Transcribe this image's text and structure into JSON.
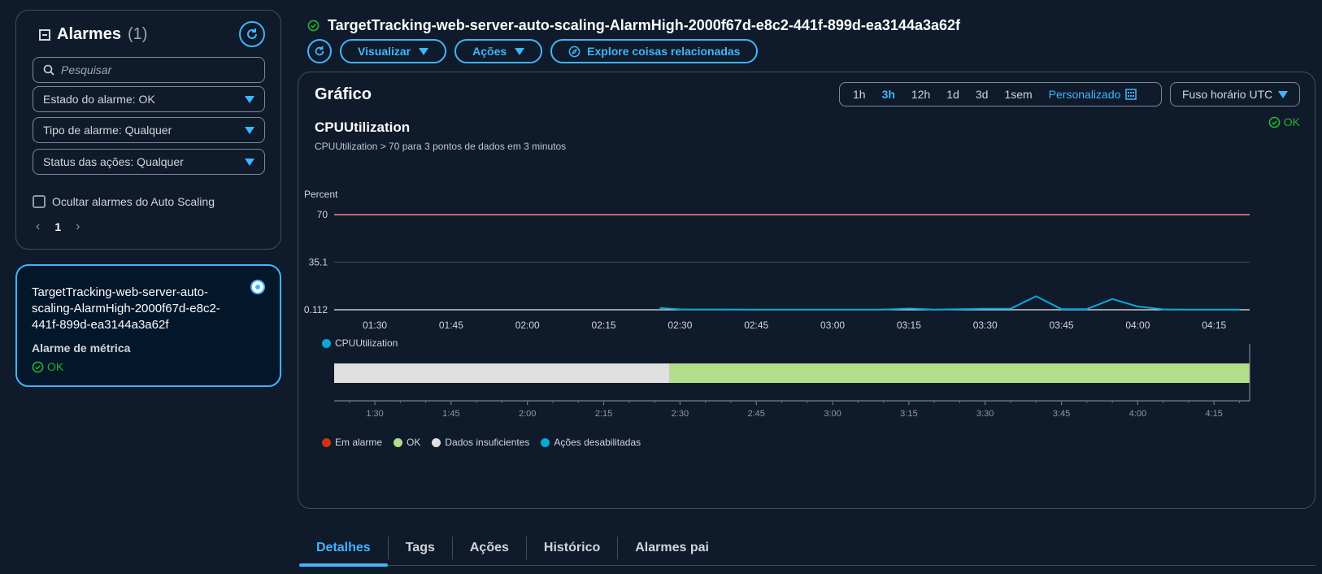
{
  "sidebar": {
    "title": "Alarmes",
    "count": "(1)",
    "search_placeholder": "Pesquisar",
    "filters": [
      {
        "label": "Estado do alarme: OK"
      },
      {
        "label": "Tipo de alarme: Qualquer"
      },
      {
        "label": "Status das ações: Qualquer"
      }
    ],
    "hide_autoscaling_label": "Ocultar alarmes do Auto Scaling",
    "page": "1",
    "alarm_card": {
      "name": "TargetTracking-web-server-auto-scaling-AlarmHigh-2000f67d-e8c2-441f-899d-ea3144a3a62f",
      "type": "Alarme de métrica",
      "status": "OK"
    }
  },
  "header": {
    "alarm_name": "TargetTracking-web-server-auto-scaling-AlarmHigh-2000f67d-e8c2-441f-899d-ea3144a3a62f",
    "buttons": {
      "view": "Visualizar",
      "actions": "Ações",
      "explore": "Explore coisas relacionadas"
    }
  },
  "graph": {
    "title": "Gráfico",
    "time_ranges": [
      "1h",
      "3h",
      "12h",
      "1d",
      "3d",
      "1sem"
    ],
    "active_range": "3h",
    "custom_label": "Personalizado",
    "timezone": "Fuso horário UTC",
    "metric_title": "CPUUtilization",
    "metric_subtitle": "CPUUtilization > 70 para 3 pontos de dados em 3 minutos",
    "status": "OK",
    "legend_cpu": "CPUUtilization",
    "state_legend": [
      {
        "label": "Em alarme",
        "color": "#d13212"
      },
      {
        "label": "OK",
        "color": "#b2de8c"
      },
      {
        "label": "Dados insuficientes",
        "color": "#e0e0e0"
      },
      {
        "label": "Ações desabilitadas",
        "color": "#0aa8d8"
      }
    ]
  },
  "chart_data": [
    {
      "type": "line",
      "ylabel": "Percent",
      "y_ticks": [
        "70",
        "35.1",
        "0.112"
      ],
      "ylim": [
        0.112,
        70
      ],
      "threshold": 70,
      "threshold_color": "#f88b76",
      "line_color": "#0aa8d8",
      "x_ticks": [
        "01:30",
        "01:45",
        "02:00",
        "02:15",
        "02:30",
        "02:45",
        "03:00",
        "03:15",
        "03:30",
        "03:45",
        "04:00",
        "04:15"
      ],
      "series": [
        {
          "name": "CPUUtilization",
          "points": [
            [
              "02:26",
              1.4
            ],
            [
              "02:30",
              0.4
            ],
            [
              "02:45",
              0.3
            ],
            [
              "03:00",
              0.3
            ],
            [
              "03:10",
              0.3
            ],
            [
              "03:15",
              1.0
            ],
            [
              "03:20",
              0.3
            ],
            [
              "03:30",
              0.9
            ],
            [
              "03:35",
              0.9
            ],
            [
              "03:40",
              10.0
            ],
            [
              "03:45",
              0.6
            ],
            [
              "03:50",
              0.6
            ],
            [
              "03:55",
              8.0
            ],
            [
              "04:00",
              2.5
            ],
            [
              "04:05",
              0.4
            ],
            [
              "04:10",
              0.3
            ],
            [
              "04:20",
              0.3
            ]
          ]
        }
      ]
    },
    {
      "type": "bar",
      "x_ticks": [
        "1:30",
        "1:45",
        "2:00",
        "2:15",
        "2:30",
        "2:45",
        "3:00",
        "3:15",
        "3:30",
        "3:45",
        "4:00",
        "4:15"
      ],
      "segments": [
        {
          "state": "Dados insuficientes",
          "from": "01:22",
          "to": "02:28",
          "color": "#e0e0e0"
        },
        {
          "state": "OK",
          "from": "02:28",
          "to": "04:22",
          "color": "#b2de8c"
        }
      ]
    }
  ],
  "tabs": [
    "Detalhes",
    "Tags",
    "Ações",
    "Histórico",
    "Alarmes pai"
  ],
  "active_tab": "Detalhes"
}
